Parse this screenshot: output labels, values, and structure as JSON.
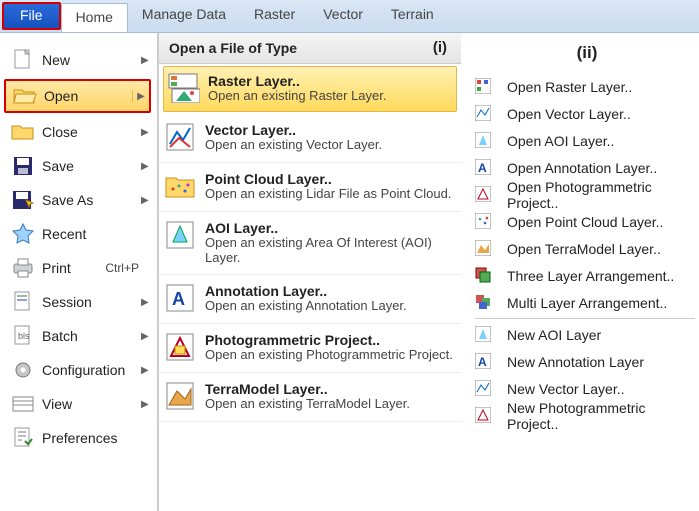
{
  "tabs": {
    "file": "File",
    "home": "Home",
    "manage": "Manage Data",
    "raster": "Raster",
    "vector": "Vector",
    "terrain": "Terrain"
  },
  "fileMenu": {
    "new": "New",
    "open": "Open",
    "close": "Close",
    "save": "Save",
    "saveAs": "Save As",
    "recent": "Recent",
    "print": "Print",
    "printSc": "Ctrl+P",
    "session": "Session",
    "batch": "Batch",
    "config": "Configuration",
    "view": "View",
    "prefs": "Preferences"
  },
  "typeHeader": "Open a File of Type",
  "labels": {
    "i": "(i)",
    "ii": "(ii)"
  },
  "types": [
    {
      "t": "Raster Layer..",
      "d": "Open an existing Raster Layer."
    },
    {
      "t": "Vector Layer..",
      "d": "Open an existing Vector Layer."
    },
    {
      "t": "Point Cloud Layer..",
      "d": "Open an existing Lidar File as Point Cloud."
    },
    {
      "t": "AOI Layer..",
      "d": "Open an existing Area Of Interest (AOI) Layer."
    },
    {
      "t": "Annotation Layer..",
      "d": "Open an existing Annotation Layer."
    },
    {
      "t": "Photogrammetric Project..",
      "d": "Open an existing Photogrammetric Project."
    },
    {
      "t": "TerraModel Layer..",
      "d": "Open an existing TerraModel Layer."
    }
  ],
  "rmenu": [
    "Open Raster Layer..",
    "Open Vector Layer..",
    "Open AOI Layer..",
    "Open Annotation Layer..",
    "Open Photogrammetric Project..",
    "Open Point Cloud Layer..",
    "Open TerraModel Layer..",
    "Three Layer Arrangement..",
    "Multi Layer Arrangement..",
    "New AOI Layer",
    "New Annotation Layer",
    "New Vector Layer..",
    "New Photogrammetric Project.."
  ]
}
